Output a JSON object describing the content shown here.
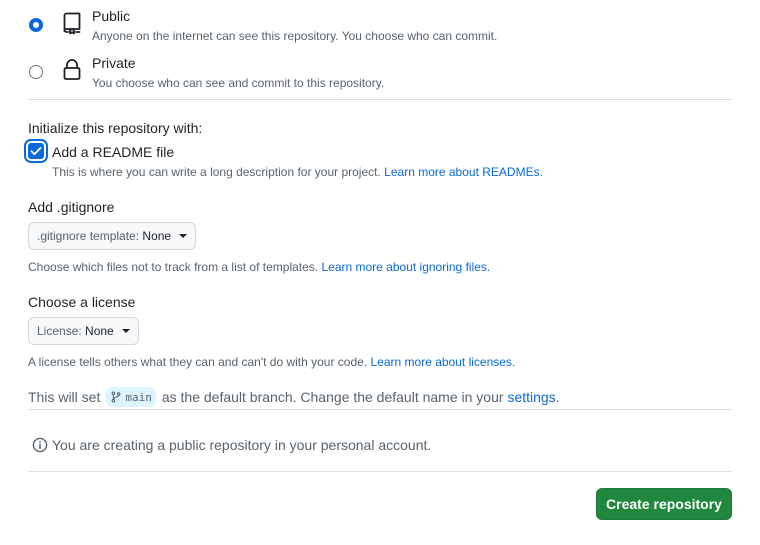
{
  "visibility": {
    "public": {
      "title": "Public",
      "description": "Anyone on the internet can see this repository. You choose who can commit.",
      "selected": true,
      "icon": "repo-icon"
    },
    "private": {
      "title": "Private",
      "description": "You choose who can see and commit to this repository.",
      "selected": false,
      "icon": "lock-icon"
    }
  },
  "initialize": {
    "heading": "Initialize this repository with:",
    "readme": {
      "label": "Add a README file",
      "checked": true,
      "help": "This is where you can write a long description for your project.",
      "link": "Learn more about READMEs."
    }
  },
  "gitignore": {
    "heading": "Add .gitignore",
    "select_prefix": ".gitignore template:",
    "select_value": "None",
    "help": "Choose which files not to track from a list of templates.",
    "link": "Learn more about ignoring files."
  },
  "license": {
    "heading": "Choose a license",
    "select_prefix": "License:",
    "select_value": "None",
    "help": "A license tells others what they can and can't do with your code.",
    "link": "Learn more about licenses."
  },
  "branch": {
    "prefix": "This will set",
    "name": "main",
    "suffix": "as the default branch. Change the default name in your",
    "link": "settings",
    "end": "."
  },
  "notice": {
    "text": "You are creating a public repository in your personal account."
  },
  "actions": {
    "create_label": "Create repository"
  },
  "colors": {
    "accent": "#0969da",
    "primary_button": "#1f883d"
  }
}
